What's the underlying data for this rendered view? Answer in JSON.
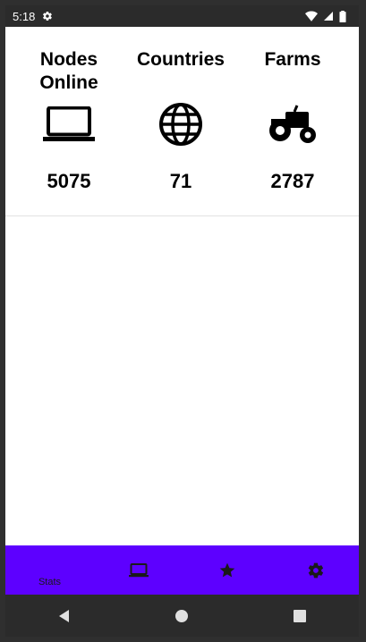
{
  "status_bar": {
    "time": "5:18",
    "icons": [
      "settings-icon",
      "wifi-icon",
      "signal-icon",
      "battery-icon"
    ]
  },
  "stats": [
    {
      "title": "Nodes Online",
      "icon": "laptop-icon",
      "value": "5075"
    },
    {
      "title": "Countries",
      "icon": "globe-icon",
      "value": "71"
    },
    {
      "title": "Farms",
      "icon": "tractor-icon",
      "value": "2787"
    }
  ],
  "bottom_nav": {
    "background": "#5d00ff",
    "items": [
      {
        "label": "Stats",
        "icon": null
      },
      {
        "label": "",
        "icon": "laptop-icon"
      },
      {
        "label": "",
        "icon": "star-icon"
      },
      {
        "label": "",
        "icon": "gear-icon"
      }
    ]
  },
  "system_nav": {
    "icons": [
      "back-icon",
      "home-icon",
      "recents-icon"
    ]
  }
}
